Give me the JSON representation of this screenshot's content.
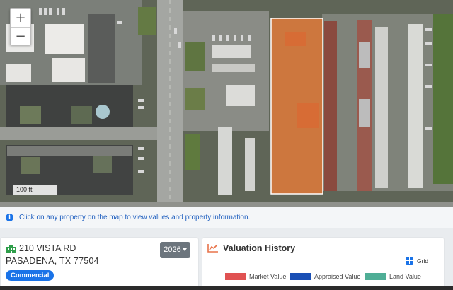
{
  "map": {
    "zoom_in_label": "+",
    "zoom_out_label": "−",
    "scale_label": "100 ft",
    "highlight_color": "#e07a3a"
  },
  "info": {
    "icon": "info-circle-icon",
    "text": "Click on any property on the map to view values and property information."
  },
  "property": {
    "icon": "building-icon",
    "address_line1": "210 VISTA RD",
    "address_line2": "PASADENA, TX 77504",
    "category": "Commercial",
    "year": "2026"
  },
  "valuation": {
    "icon": "line-chart-icon",
    "title": "Valuation History",
    "grid_label": "Grid",
    "legend": [
      {
        "label": "Market Value",
        "color": "#e05252"
      },
      {
        "label": "Appraised Value",
        "color": "#1a4fb5"
      },
      {
        "label": "Land Value",
        "color": "#4fae96"
      }
    ]
  }
}
